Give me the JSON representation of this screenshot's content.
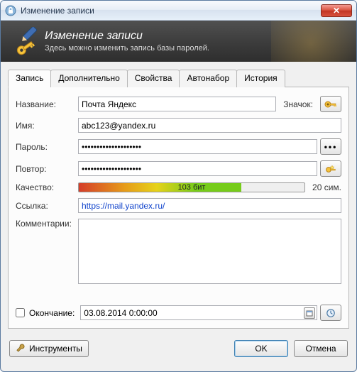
{
  "window": {
    "title": "Изменение записи"
  },
  "header": {
    "title": "Изменение записи",
    "subtitle": "Здесь можно изменить запись базы паролей."
  },
  "tabs": {
    "t0": "Запись",
    "t1": "Дополнительно",
    "t2": "Свойства",
    "t3": "Автонабор",
    "t4": "История"
  },
  "labels": {
    "name": "Название:",
    "iconLabel": "Значок:",
    "username": "Имя:",
    "password": "Пароль:",
    "repeat": "Повтор:",
    "quality": "Качество:",
    "url": "Ссылка:",
    "comments": "Комментарии:",
    "expires": "Окончание:"
  },
  "values": {
    "name": "Почта Яндекс",
    "username": "abc123@yandex.ru",
    "password": "••••••••••••••••••••",
    "repeat": "••••••••••••••••••••",
    "qualityText": "103 бит",
    "qualityCount": "20 сим.",
    "url": "https://mail.yandex.ru/",
    "comments": "",
    "expires": "03.08.2014   0:00:00"
  },
  "buttons": {
    "tools": "Инструменты",
    "ok": "OK",
    "cancel": "Отмена"
  },
  "colors": {
    "accent": "#3c7fb1"
  }
}
